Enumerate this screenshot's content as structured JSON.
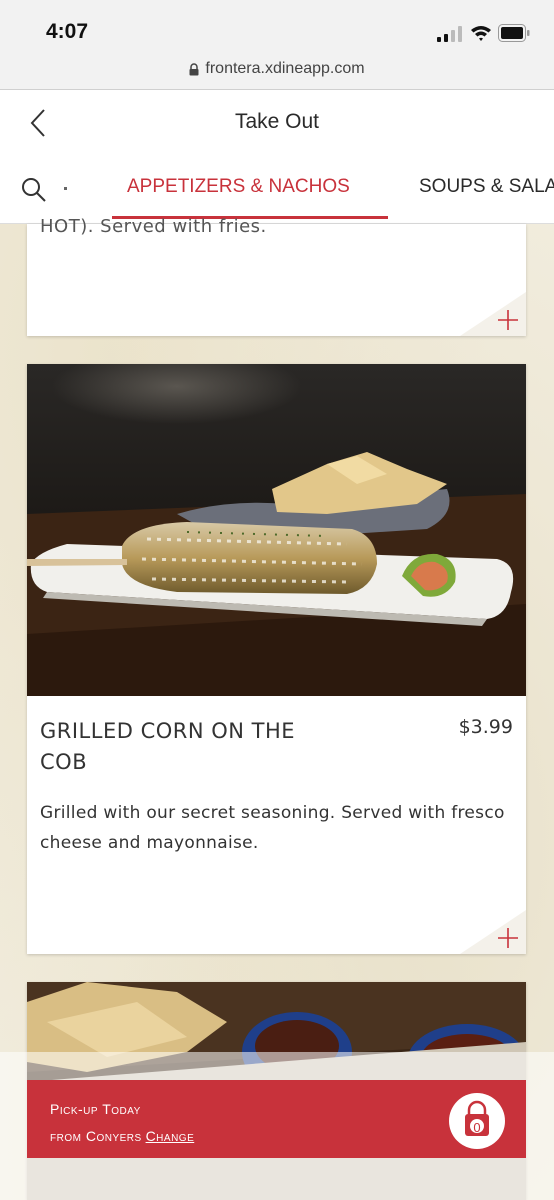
{
  "status_bar": {
    "time": "4:07"
  },
  "browser": {
    "url": "frontera.xdineapp.com"
  },
  "header": {
    "title": "Take Out",
    "tabs": [
      {
        "label": "APPETIZERS & NACHOS",
        "active": true
      },
      {
        "label": "SOUPS & SALA",
        "active": false
      }
    ]
  },
  "previous_item": {
    "description_tail": "HOT). Served with fries."
  },
  "item": {
    "name": "GRILLED CORN ON THE COB",
    "price": "$3.99",
    "description": "Grilled with our secret seasoning. Served with fresco cheese and mayonnaise."
  },
  "pickup": {
    "line1": "Pick-up Today",
    "line2_prefix": "from Conyers",
    "change_label": "Change",
    "cart_count": "0"
  },
  "colors": {
    "accent": "#c8323b",
    "background": "#f1ecdd",
    "card": "#ffffff"
  }
}
